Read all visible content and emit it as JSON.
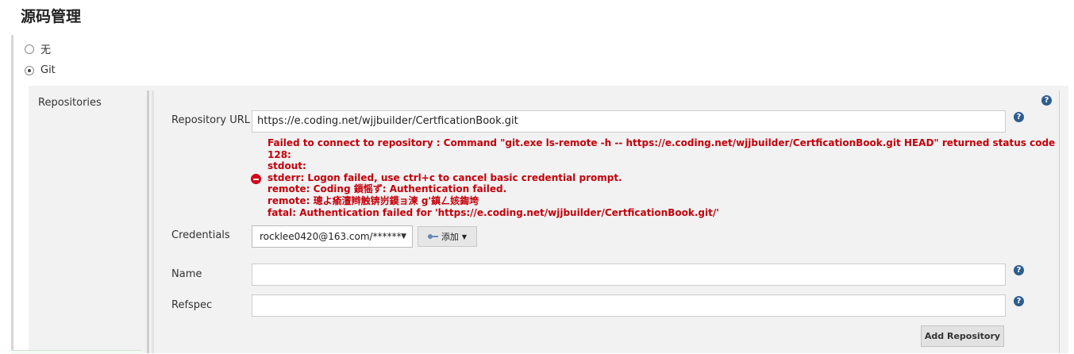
{
  "section": {
    "title": "源码管理"
  },
  "scm_options": [
    {
      "label": "无",
      "selected": false
    },
    {
      "label": "Git",
      "selected": true
    }
  ],
  "git": {
    "repositories_label": "Repositories",
    "repository_url": {
      "label": "Repository URL",
      "value": "https://e.coding.net/wjjbuilder/CertficationBook.git"
    },
    "error_lines": [
      "Failed to connect to repository : Command \"git.exe ls-remote -h -- https://e.coding.net/wjjbuilder/CertficationBook.git HEAD\" returned status code",
      "128:",
      "stdout:",
      "stderr: Logon failed, use ctrl+c to cancel basic credential prompt.",
      "remote: Coding 鎻愮ず: Authentication failed.",
      "remote: 璁よ瘉澶辫触锛岃鏌ョ湅 g'鎮ㄥ姟鍧垮",
      "fatal: Authentication failed for 'https://e.coding.net/wjjbuilder/CertficationBook.git/'"
    ],
    "credentials": {
      "label": "Credentials",
      "selected": "rocklee0420@163.com/******",
      "add_button": "添加"
    },
    "name": {
      "label": "Name",
      "value": ""
    },
    "refspec": {
      "label": "Refspec",
      "value": ""
    },
    "add_repository_button": "Add Repository"
  },
  "help_icon_glyph": "?",
  "colors": {
    "error": "#c4000a",
    "help_icon": "#2e5d8f",
    "panel_bg": "#f2f2f2"
  }
}
